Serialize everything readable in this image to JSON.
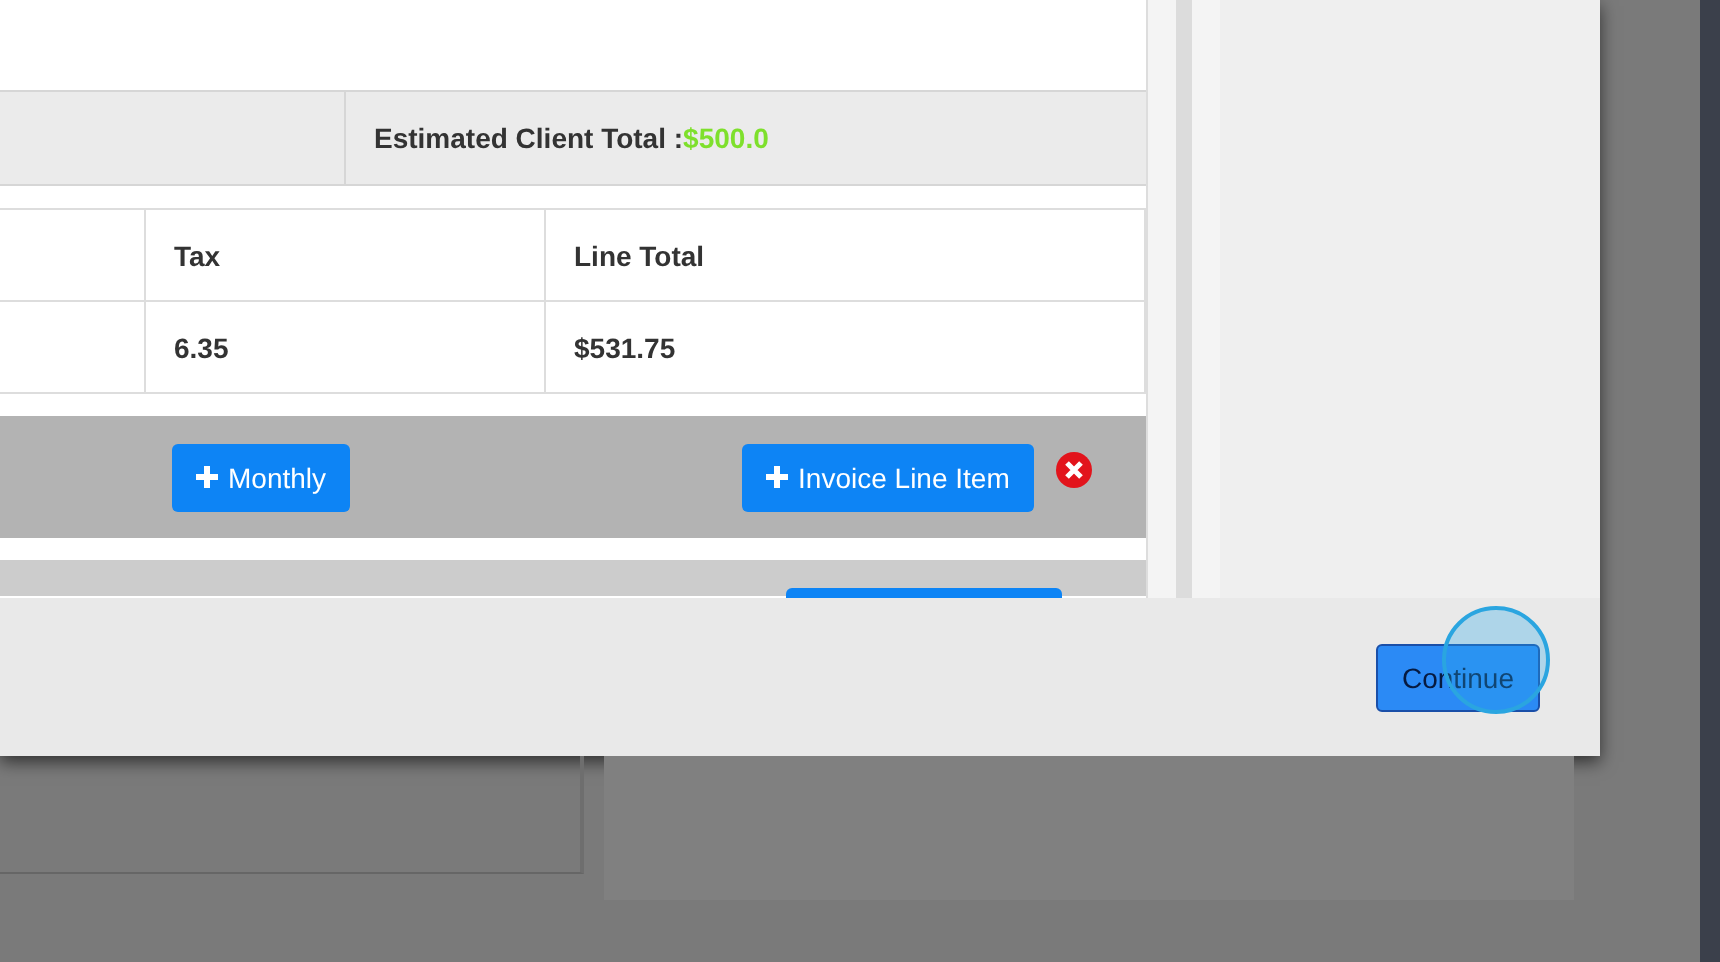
{
  "summary": {
    "label": "Estimated Client Total :",
    "amount": "$500.0"
  },
  "table": {
    "columns": [
      "Tax",
      "Line Total"
    ],
    "rows": [
      [
        "6.35",
        "$531.75"
      ]
    ]
  },
  "actions": [
    {
      "label": "Monthly"
    },
    {
      "label": "Invoice Line Item"
    }
  ],
  "footer": {
    "button": "Continue"
  }
}
